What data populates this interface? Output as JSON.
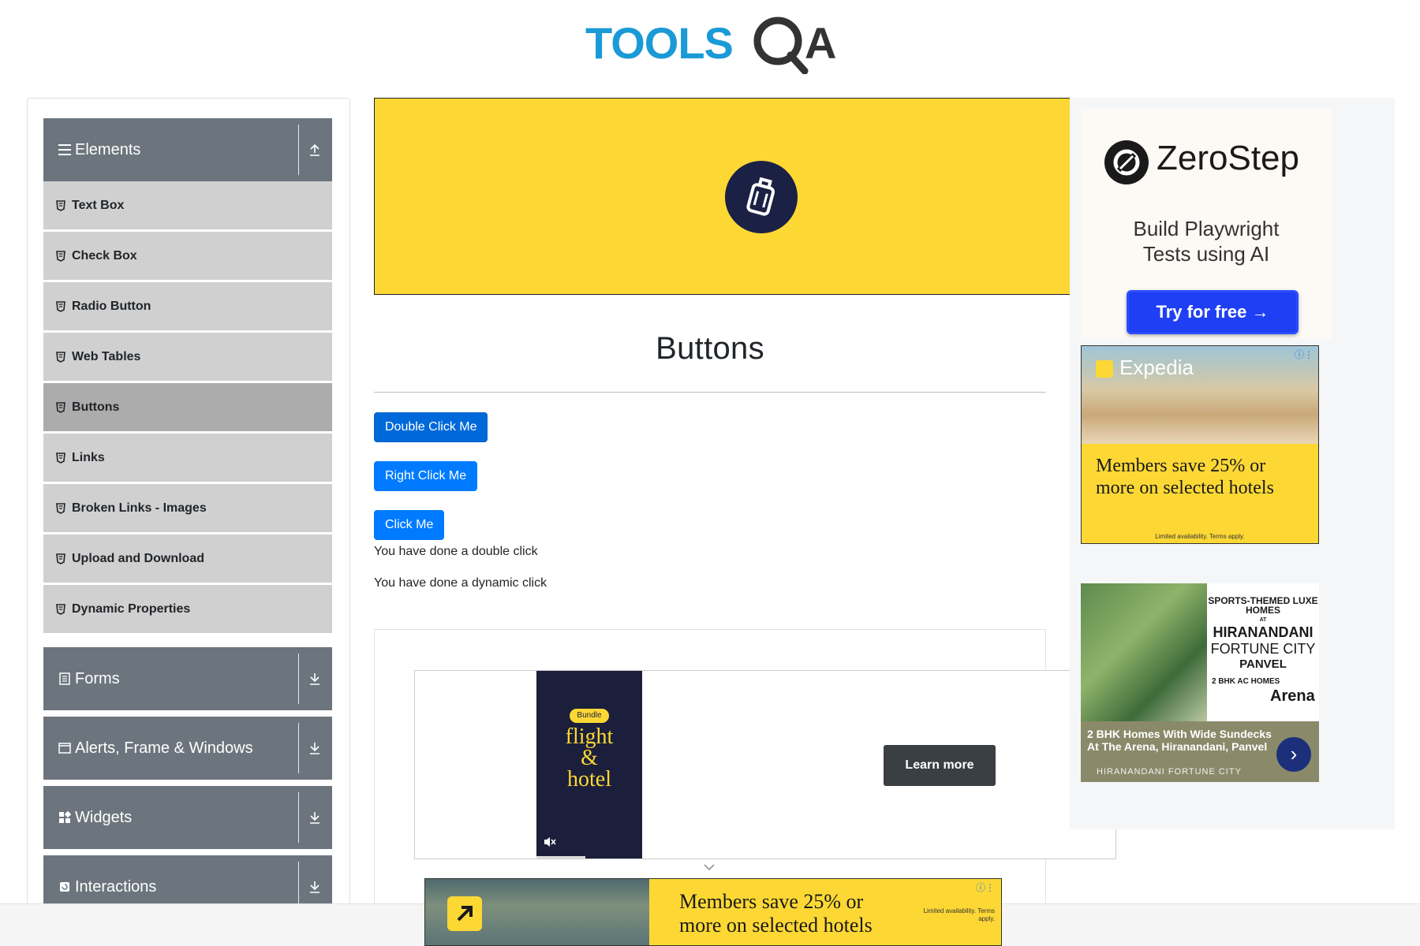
{
  "header": {
    "logo_text": "TOOLSQA"
  },
  "sidebar": {
    "groups": [
      {
        "label": "Elements",
        "icon": "menu-icon",
        "arrow": "collapse-arrow-icon"
      },
      {
        "label": "Forms",
        "icon": "form-icon",
        "arrow": "expand-arrow-icon"
      },
      {
        "label": "Alerts, Frame & Windows",
        "icon": "window-icon",
        "arrow": "expand-arrow-icon"
      },
      {
        "label": "Widgets",
        "icon": "widgets-icon",
        "arrow": "expand-arrow-icon"
      },
      {
        "label": "Interactions",
        "icon": "interactions-icon",
        "arrow": "expand-arrow-icon"
      }
    ],
    "items": [
      {
        "label": "Text Box"
      },
      {
        "label": "Check Box"
      },
      {
        "label": "Radio Button"
      },
      {
        "label": "Web Tables"
      },
      {
        "label": "Buttons",
        "active": true
      },
      {
        "label": "Links"
      },
      {
        "label": "Broken Links - Images"
      },
      {
        "label": "Upload and Download"
      },
      {
        "label": "Dynamic Properties"
      }
    ]
  },
  "main": {
    "title": "Buttons",
    "buttons": {
      "double_click": "Double Click Me",
      "right_click": "Right Click Me",
      "click": "Click Me"
    },
    "messages": {
      "double": "You have done a double click",
      "dynamic": "You have done a dynamic click"
    }
  },
  "ads": {
    "video": {
      "badge": "Bundle",
      "line1": "flight",
      "line2": "&",
      "line3": "hotel",
      "cta": "Learn more"
    },
    "zerostep": {
      "brand": "ZeroStep",
      "tagline_1": "Build Playwright",
      "tagline_2": "Tests using AI",
      "cta": "Try for free →"
    },
    "expedia": {
      "brand": "Expedia",
      "text": "Members save 25% or more on selected hotels",
      "fine": "Limited availability. Terms apply."
    },
    "hiranandani": {
      "h1": "SPORTS-THEMED LUXE HOMES",
      "at": "AT",
      "h2": "HIRANANDANI",
      "h3": "FORTUNE CITY",
      "h4": "PANVEL",
      "h5": "2 BHK AC HOMES",
      "arena": "Arena",
      "desc": "2 BHK Homes With Wide Sundecks At The Arena, Hiranandani, Panvel",
      "name": "HIRANANDANI FORTUNE CITY"
    },
    "bottom": {
      "text_1": "Members save 25% or",
      "text_2": "more on selected hotels",
      "fine": "Limited availability. Terms apply."
    }
  },
  "colors": {
    "accent": "#007bff",
    "sidebar_header": "#6c757d",
    "sidebar_item": "#d0d0d0",
    "sidebar_active": "#acacac",
    "banner": "#fdd835"
  }
}
